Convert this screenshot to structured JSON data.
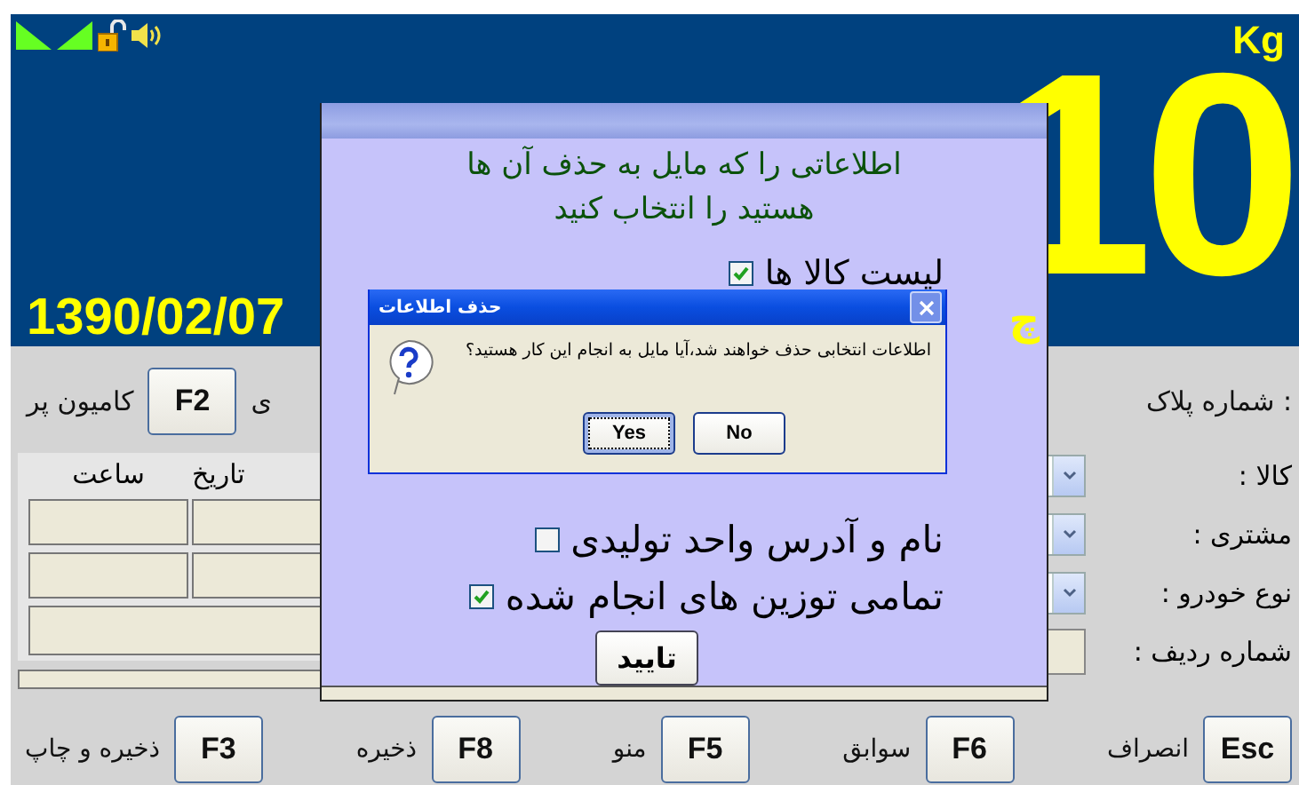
{
  "weight": {
    "value": "10",
    "unit": "Kg"
  },
  "date": "1390/02/07",
  "day_partial": "چ",
  "plate_label": "شماره پلاک :",
  "loaded_truck": {
    "key": "F2",
    "label": "کامیون پر"
  },
  "partial_label": "ی",
  "fields": [
    {
      "label": "کالا :",
      "kind": "combo"
    },
    {
      "label": "مشتری :",
      "kind": "combo"
    },
    {
      "label": "نوع خودرو :",
      "kind": "combo"
    },
    {
      "label": "شماره ردیف :",
      "kind": "text"
    }
  ],
  "table": {
    "columns": [
      "تاریخ",
      "ساعت"
    ]
  },
  "actions": [
    {
      "key": "Esc",
      "label": "انصراف"
    },
    {
      "key": "F6",
      "label": "سوابق"
    },
    {
      "key": "F5",
      "label": "منو"
    },
    {
      "key": "F8",
      "label": "ذخیره"
    },
    {
      "key": "F3",
      "label": "ذخیره و چاپ"
    }
  ],
  "delete_dialog": {
    "prompt_lines": [
      "اطلاعاتی را که مایل به حذف آن ها",
      "هستید را انتخاب کنید"
    ],
    "options": [
      {
        "label": "لیست کالا ها",
        "checked": true
      },
      {
        "label": "نام و آدرس واحد تولیدی",
        "checked": false
      },
      {
        "label": "تمامی توزین های انجام شده",
        "checked": true
      }
    ],
    "confirm": "تایید"
  },
  "message_box": {
    "title": "حذف اطلاعات",
    "message": "اطلاعات انتخابی حذف خواهند شد،آیا مایل به انجام این کار هستید؟",
    "buttons": [
      {
        "label": "No",
        "selected": false
      },
      {
        "label": "Yes",
        "selected": true
      }
    ]
  }
}
